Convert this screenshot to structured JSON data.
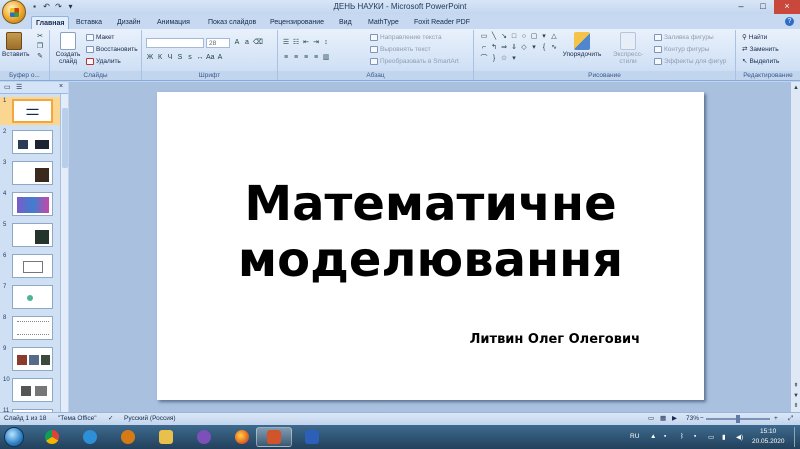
{
  "window": {
    "title": "ДЕНЬ НАУКИ - Microsoft PowerPoint",
    "controls": [
      "–",
      "□",
      "×"
    ]
  },
  "tabs": [
    "Главная",
    "Вставка",
    "Дизайн",
    "Анимация",
    "Показ слайдов",
    "Рецензирование",
    "Вид",
    "MathType",
    "Foxit Reader PDF"
  ],
  "ribbon": {
    "clipboard": {
      "paste": "Вставить",
      "label": "Буфер о..."
    },
    "slides": {
      "new_slide": "Создать слайд",
      "layout": "Макет",
      "reset": "Восстановить",
      "delete": "Удалить",
      "label": "Слайды"
    },
    "font": {
      "size": "28",
      "label": "Шрифт"
    },
    "paragraph": {
      "text_direction": "Направление текста",
      "align_text": "Выровнять текст",
      "smartart": "Преобразовать в SmartArt",
      "label": "Абзац"
    },
    "drawing": {
      "arrange": "Упорядочить",
      "quick_styles": "Экспресс-стили",
      "fill": "Заливка фигуры",
      "outline": "Контур фигуры",
      "effects": "Эффекты для фигур",
      "label": "Рисование"
    },
    "editing": {
      "find": "Найти",
      "replace": "Заменить",
      "select": "Выделить",
      "label": "Редактирование"
    }
  },
  "slide_panel": {
    "tab_slides": "Слайды",
    "tab_outline": "Структура",
    "thumbnails": [
      "1",
      "2",
      "3",
      "4",
      "5",
      "6",
      "7",
      "8",
      "9",
      "10",
      "11"
    ]
  },
  "slide": {
    "title_line1": "Математичне",
    "title_line2": "моделювання",
    "subtitle": "Литвин Олег Олегович"
  },
  "status": {
    "slide_info": "Слайд 1 из 18",
    "theme": "\"Тема Office\"",
    "language": "Русский (Россия)",
    "zoom": "73%"
  },
  "taskbar": {
    "lang": "RU",
    "time": "15:10",
    "date": "20.05.2020"
  },
  "colors": {
    "ribbon": "#d3e2f6",
    "selected_thumb": "#f1a640",
    "taskbar": "#22415c"
  }
}
